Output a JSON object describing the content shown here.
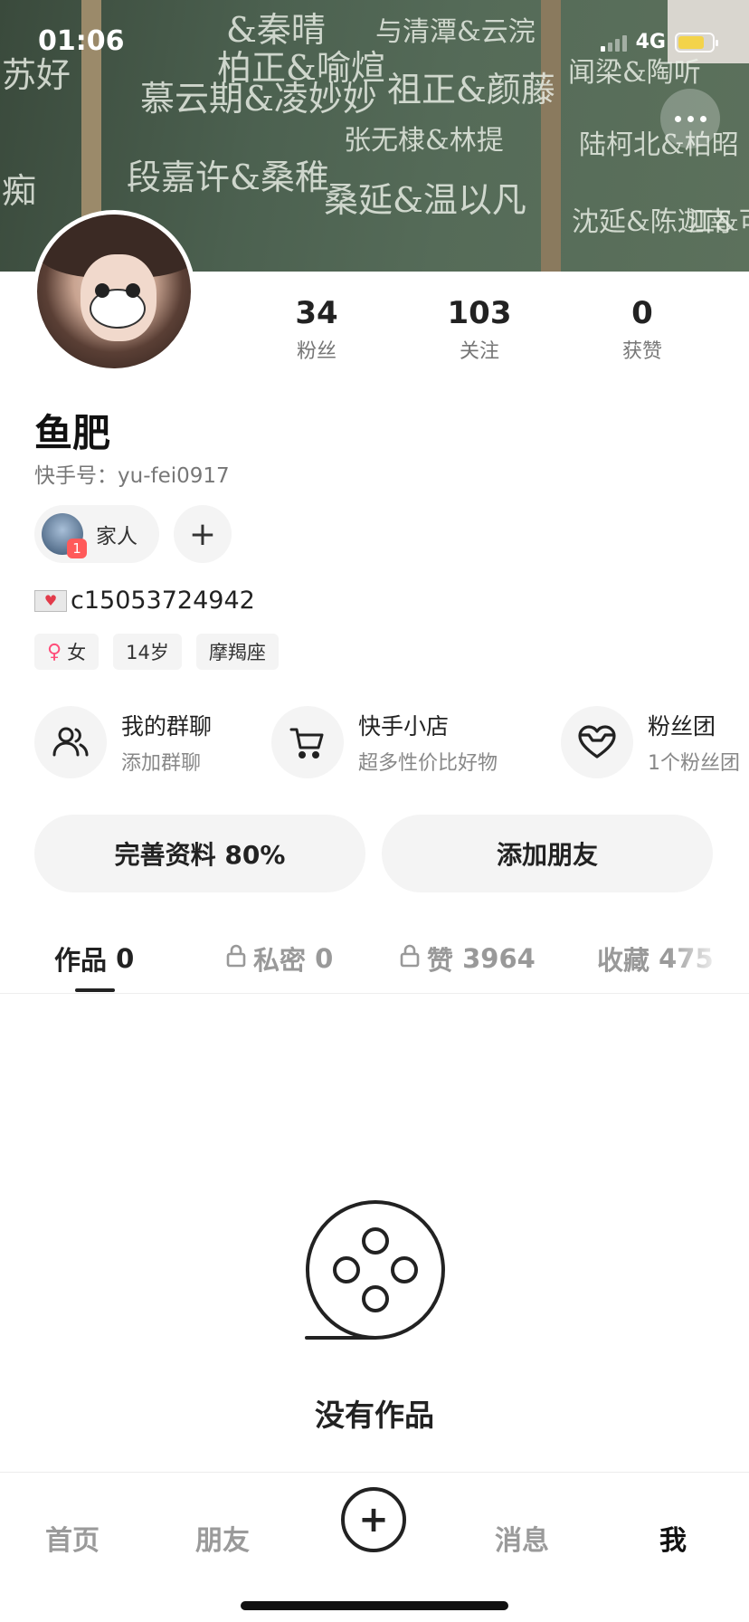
{
  "status_bar": {
    "time": "01:06",
    "network": "4G"
  },
  "cover": {
    "chalk_lines": [
      "苏好",
      "&秦晴",
      "与清潭&云浣",
      "柏正&喻煊",
      "慕云期&凌妙妙",
      "祖正&颜藤",
      "段嘉许&桑稚",
      "张无棣&林提",
      "桑延&温以凡",
      "痴",
      "闻梁&陶听",
      "陆柯北&柏昭",
      "沈延&陈迦南",
      "江&可"
    ]
  },
  "profile": {
    "name": "鱼肥",
    "kuaishou_id": "快手号：yu-fei0917",
    "family_label": "家人",
    "family_badge": "1",
    "add_label": "+",
    "contact": "c15053724942",
    "tags": [
      {
        "icon": "female-icon",
        "text": "女"
      },
      {
        "text": "14岁"
      },
      {
        "text": "摩羯座"
      }
    ]
  },
  "stats": [
    {
      "value": "34",
      "label": "粉丝"
    },
    {
      "value": "103",
      "label": "关注"
    },
    {
      "value": "0",
      "label": "获赞"
    }
  ],
  "features": [
    {
      "icon": "group-chat-icon",
      "title": "我的群聊",
      "subtitle": "添加群聊"
    },
    {
      "icon": "cart-icon",
      "title": "快手小店",
      "subtitle": "超多性价比好物"
    },
    {
      "icon": "heart-icon",
      "title": "粉丝团",
      "subtitle": "1个粉丝团"
    }
  ],
  "buttons": {
    "complete_profile": "完善资料 80%",
    "add_friend": "添加朋友"
  },
  "tabs": [
    {
      "label": "作品",
      "count": "0",
      "active": true
    },
    {
      "label": "私密",
      "count": "0",
      "locked": true
    },
    {
      "label": "赞",
      "count": "3964",
      "locked": true
    },
    {
      "label": "收藏",
      "count": "475"
    }
  ],
  "empty_state": {
    "text": "没有作品"
  },
  "bottom_nav": {
    "home": "首页",
    "friends": "朋友",
    "plus": "+",
    "messages": "消息",
    "me": "我"
  }
}
